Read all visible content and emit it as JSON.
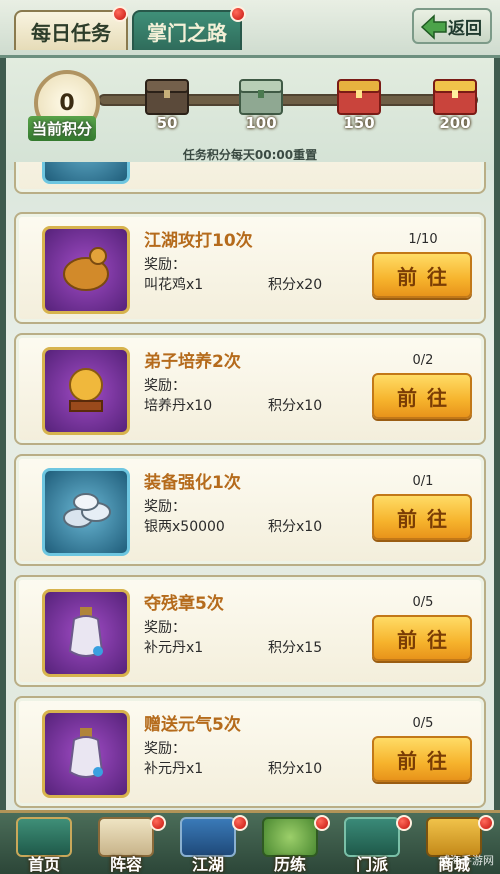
{
  "tabs": {
    "daily_tasks": "每日任务",
    "sect_road": "掌门之路",
    "back": "返回"
  },
  "progress": {
    "current_points": "0",
    "current_points_label": "当前积分",
    "milestones": [
      "50",
      "100",
      "150",
      "200"
    ],
    "reset_note": "任务积分每天00:00重置"
  },
  "tasks": [
    {
      "title": "江湖攻打10次",
      "reward_label": "奖励：",
      "reward_item": "叫花鸡x1",
      "reward_points": "积分x20",
      "progress": "1/10",
      "button": "前往",
      "icon": "roast-chicken-icon"
    },
    {
      "title": "弟子培养2次",
      "reward_label": "奖励：",
      "reward_item": "培养丹x10",
      "reward_points": "积分x10",
      "progress": "0/2",
      "button": "前往",
      "icon": "golden-orb-icon"
    },
    {
      "title": "装备强化1次",
      "reward_label": "奖励：",
      "reward_item": "银两x50000",
      "reward_points": "积分x10",
      "progress": "0/1",
      "button": "前往",
      "icon": "silver-ingots-icon"
    },
    {
      "title": "夺残章5次",
      "reward_label": "奖励：",
      "reward_item": "补元丹x1",
      "reward_points": "积分x15",
      "progress": "0/5",
      "button": "前往",
      "icon": "potion-bottle-icon"
    },
    {
      "title": "赠送元气5次",
      "reward_label": "奖励：",
      "reward_item": "补元丹x1",
      "reward_points": "积分x10",
      "progress": "0/5",
      "button": "前往",
      "icon": "potion-bottle-icon"
    }
  ],
  "nav": [
    "首页",
    "阵容",
    "江湖",
    "历练",
    "门派",
    "商城"
  ],
  "watermark": "威海手游网"
}
